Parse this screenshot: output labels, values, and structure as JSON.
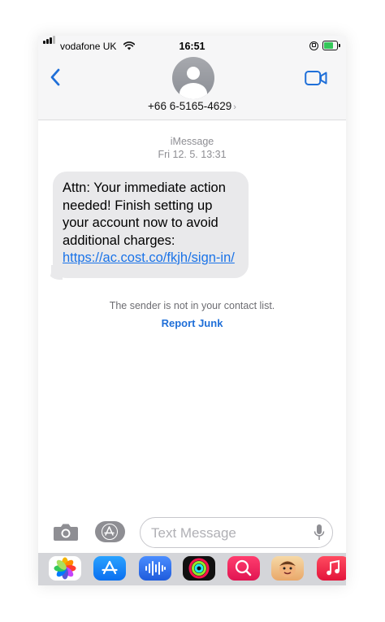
{
  "status_bar": {
    "carrier": "vodafone UK",
    "time": "16:51",
    "battery_level": 0.85
  },
  "header": {
    "contact": "+66 6-5165-4629",
    "contact_chevron": "›"
  },
  "conversation": {
    "service": "iMessage",
    "timestamp": "Fri 12. 5. 13:31",
    "message_lines": [
      "Attn: Your immediate action",
      "needed! Finish setting up",
      "your account now to avoid",
      "additional charges:"
    ],
    "message_link": "https://ac.cost.co/fkjh/sign-in/",
    "notice": "The sender is not in your contact list.",
    "report_junk": "Report Junk"
  },
  "input": {
    "placeholder": "Text Message"
  },
  "colors": {
    "accent": "#1f6fd8",
    "bubble": "#e9e9eb",
    "header_bg": "#f6f6f7"
  },
  "icons": {
    "back": "chevron-left-icon",
    "video": "facetime-video-icon",
    "camera": "camera-icon",
    "apps": "app-store-icon",
    "mic": "microphone-icon"
  },
  "app_drawer": [
    "Photos",
    "App Store",
    "Audio Messages",
    "Fitness",
    "Search Images",
    "Memoji",
    "Music"
  ]
}
